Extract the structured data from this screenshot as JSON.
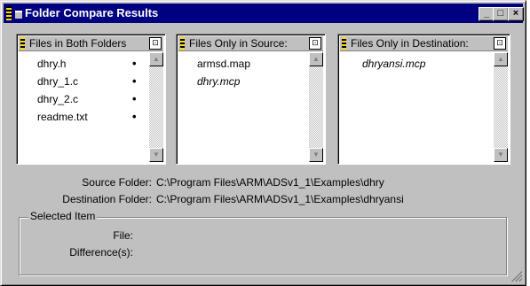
{
  "window": {
    "title": "Folder Compare Results",
    "minimize": "_",
    "maximize": "□",
    "close": "×"
  },
  "panels": {
    "both": {
      "header": "Files in Both Folders",
      "items": [
        {
          "name": "dhry.h",
          "marker": "•"
        },
        {
          "name": "dhry_1.c",
          "marker": "•"
        },
        {
          "name": "dhry_2.c",
          "marker": "•"
        },
        {
          "name": "readme.txt",
          "marker": "•"
        }
      ]
    },
    "source": {
      "header": "Files Only in Source:",
      "items": [
        {
          "name": "armsd.map"
        },
        {
          "name": "dhry.mcp"
        }
      ]
    },
    "destination": {
      "header": "Files Only in Destination:",
      "items": [
        {
          "name": "dhryansi.mcp"
        }
      ]
    }
  },
  "info": {
    "source_label": "Source Folder:",
    "source_value": "C:\\Program Files\\ARM\\ADSv1_1\\Examples\\dhry",
    "dest_label": "Destination Folder:",
    "dest_value": "C:\\Program Files\\ARM\\ADSv1_1\\Examples\\dhryansi"
  },
  "selected": {
    "legend": "Selected Item",
    "file_label": "File:",
    "diff_label": "Difference(s):"
  },
  "colors": {
    "titlebar": "#000080",
    "face": "#c0c0c0"
  }
}
